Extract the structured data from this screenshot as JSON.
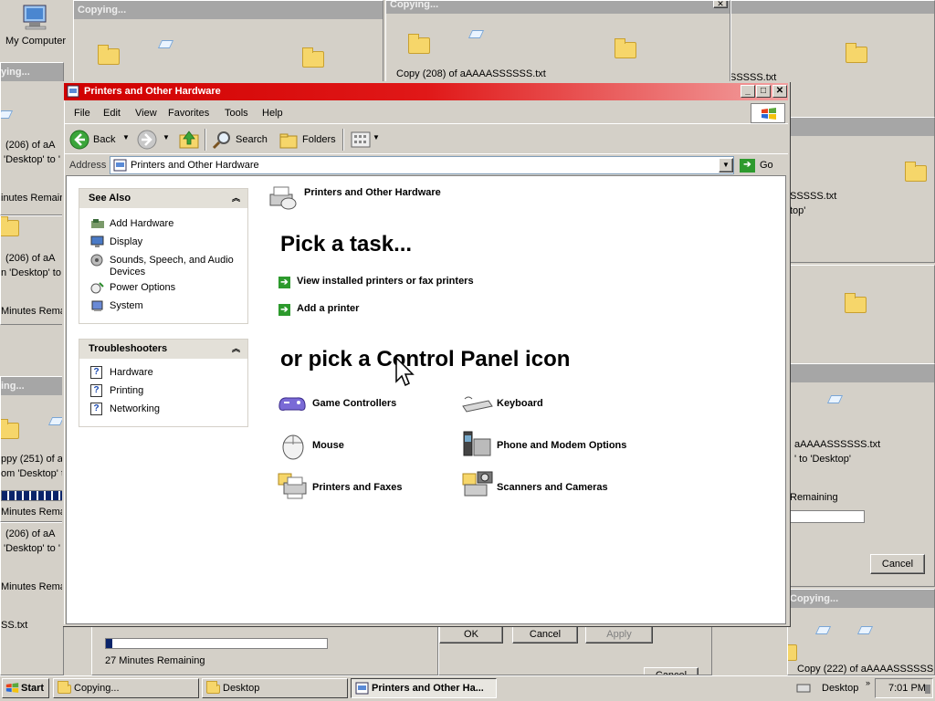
{
  "desktop": {
    "my_computer_label": "My Computer"
  },
  "bg_dialogs": {
    "copying_title": "Copying...",
    "copy208": "Copy (208) of aAAAASSSSSS.txt",
    "copy206": "(206) of aA",
    "copy206b": "(206) of aA",
    "desktop_to": "'Desktop' to '",
    "desktop_to2": "n 'Desktop' to",
    "minutes_remain": "inutes Remain",
    "minutes_remai": "Minutes Remai",
    "minutes_remain2": "Minutes Remain",
    "minutes_remain3": "Minutes Remain",
    "copy251": "ppy (251) of a",
    "from_desktop": "om 'Desktop' t",
    "desktop_to3": "'Desktop' to '",
    "ss_txt": "SS.txt",
    "copying_left": "ying...",
    "copying_left2": "ing...",
    "right_sssss": "SSSSS.txt",
    "right_sssss2": "SSSSS.txt",
    "right_top": "top'",
    "right_aaaa": "aAAAASSSSSS.txt",
    "right_to_desktop": "' to 'Desktop'",
    "right_remaining": "Remaining",
    "cancel": "Cancel",
    "cancel2": "Cancel",
    "copying_right": "Copying...",
    "copy222": "Copy (222) of aAAAASSSSSS.txt",
    "minutes_27": "27 Minutes Remaining",
    "ok": "OK",
    "cancel3": "Cancel",
    "apply": "Apply",
    "progress_fraction": 0.03,
    "left_progress_fraction": 1.0
  },
  "window": {
    "title": "Printers and Other Hardware",
    "menus": [
      "File",
      "Edit",
      "View",
      "Favorites",
      "Tools",
      "Help"
    ],
    "toolbar": {
      "back": "Back",
      "search": "Search",
      "folders": "Folders"
    },
    "address": {
      "label": "Address",
      "value": "Printers and Other Hardware",
      "go": "Go"
    },
    "see_also": {
      "title": "See Also",
      "items": [
        "Add Hardware",
        "Display",
        "Sounds, Speech, and Audio",
        "Devices",
        "Power Options",
        "System"
      ]
    },
    "troubleshooters": {
      "title": "Troubleshooters",
      "items": [
        "Hardware",
        "Printing",
        "Networking"
      ]
    },
    "header": "Printers and Other Hardware",
    "pick_task": "Pick a task...",
    "tasks": [
      "View installed printers or fax printers",
      "Add a printer"
    ],
    "pick_icon": "or pick a Control Panel icon",
    "icons": [
      "Game Controllers",
      "Keyboard",
      "Mouse",
      "Phone and Modem Options",
      "Printers and Faxes",
      "Scanners and Cameras"
    ]
  },
  "taskbar": {
    "start": "Start",
    "items": [
      "Copying...",
      "Desktop",
      "Printers and Other Ha..."
    ],
    "tray_desktop": "Desktop",
    "time": "7:01 PM"
  },
  "colors": {
    "title_active": "#d00000",
    "title_inactive": "#a6a6a6",
    "face": "#d4d0c8"
  }
}
